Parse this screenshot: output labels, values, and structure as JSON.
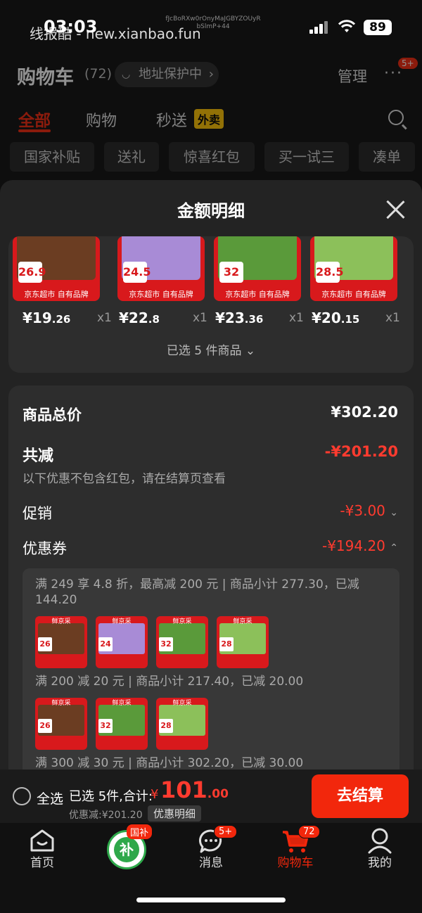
{
  "status": {
    "time": "03:03",
    "battery": "89",
    "watermark": "线报酷 - new.xianbao.fun",
    "tiny_watermark": "fJcBoRXw0rOnyMaJGBYZOUyR bSlmP+44"
  },
  "header": {
    "title": "购物车",
    "count": "(72)",
    "address": "地址保护中",
    "manage": "管理",
    "more_badge": "5+"
  },
  "tabs": [
    {
      "label": "全部"
    },
    {
      "label": "购物"
    },
    {
      "label": "秒送"
    }
  ],
  "tab_tag": "外卖",
  "chips": [
    "国家补贴",
    "送礼",
    "惊喜红包",
    "买一试三",
    "凑单"
  ],
  "sheet": {
    "title": "金额明细",
    "products": [
      {
        "label": "京东超市 自有品牌",
        "badge": "26.9",
        "price_int": "¥19",
        "price_dec": ".26",
        "qty": "x1",
        "color": "#6b3d22"
      },
      {
        "label": "京东超市 自有品牌",
        "badge": "24.5",
        "price_int": "¥22",
        "price_dec": ".8",
        "qty": "x1",
        "color": "#a88bd6"
      },
      {
        "label": "京东超市 自有品牌",
        "badge": "32",
        "price_int": "¥23",
        "price_dec": ".36",
        "qty": "x1",
        "color": "#5a9a3a"
      },
      {
        "label": "京东超市 自有品牌",
        "badge": "28.5",
        "price_int": "¥20",
        "price_dec": ".15",
        "qty": "x1",
        "color": "#8cc05a"
      }
    ],
    "selected_text": "已选 5 件商品",
    "total_label": "商品总价",
    "total_value": "¥302.20",
    "reduce_label": "共减",
    "reduce_value": "-¥201.20",
    "reduce_note": "以下优惠不包含红包，请在结算页查看",
    "promo_label": "促销",
    "promo_value": "-¥3.00",
    "coupon_label": "优惠券",
    "coupon_value": "-¥194.20",
    "coupon_groups": [
      {
        "text": "满 249 享 4.8 折，最高减 200 元 | 商品小计 277.30，已减 144.20"
      },
      {
        "text": "满 200 减 20 元 | 商品小计 217.40，已减 20.00"
      },
      {
        "text": "满 300 减 30 元 | 商品小计 302.20，已减 30.00"
      }
    ],
    "thumb_top": "鲜京采",
    "thumbs_row1": [
      {
        "price": "26",
        "color": "#6b3d22"
      },
      {
        "price": "24",
        "color": "#a88bd6"
      },
      {
        "price": "32",
        "color": "#5a9a3a"
      },
      {
        "price": "28",
        "color": "#8cc05a"
      }
    ],
    "thumbs_row2": [
      {
        "price": "26",
        "color": "#6b3d22"
      },
      {
        "price": "32",
        "color": "#5a9a3a"
      },
      {
        "price": "28",
        "color": "#8cc05a"
      }
    ]
  },
  "bottom": {
    "select_all": "全选",
    "chosen": "已选 5件,合计:",
    "yen": "¥",
    "amount_int": "101",
    "amount_dec": ".00",
    "discount": "优惠减:¥201.20",
    "detail": "优惠明细",
    "checkout": "去结算"
  },
  "nav": [
    {
      "label": "首页"
    },
    {
      "label": "",
      "tag": "国补",
      "glyph": "补"
    },
    {
      "label": "消息",
      "badge": "5+"
    },
    {
      "label": "购物车",
      "badge": "72"
    },
    {
      "label": "我的"
    }
  ],
  "colors": {
    "accent": "#f2270c",
    "discount_red": "#ff3b2f",
    "sheet_bg": "#232323",
    "card_bg": "#2d2d2d"
  }
}
